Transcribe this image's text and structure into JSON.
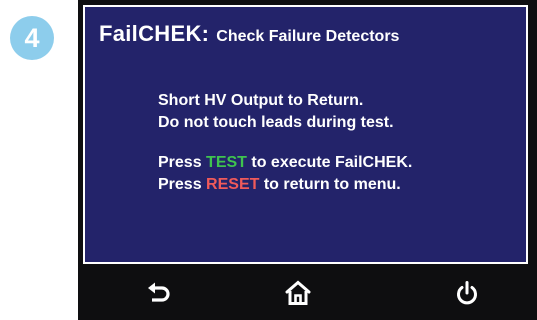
{
  "step": {
    "number": "4"
  },
  "screen": {
    "title": "FailCHEK:",
    "subtitle": "Check Failure Detectors",
    "lines": {
      "line1": "Short  HV  Output to Return.",
      "line2": "Do not touch leads during test.",
      "line3_prefix": "Press ",
      "line3_key": "TEST",
      "line3_suffix": " to execute FailCHEK.",
      "line4_prefix": "Press ",
      "line4_key": "RESET",
      "line4_suffix": " to return to menu."
    }
  },
  "navbar": {
    "buttons": [
      {
        "icon": "back-arrow-icon"
      },
      {
        "icon": "home-icon"
      },
      {
        "icon": "power-icon"
      }
    ]
  },
  "colors": {
    "screen_background": "#23236a",
    "test_keyword": "#3fc44f",
    "reset_keyword": "#f05a5a",
    "badge": "#8dcdec"
  }
}
